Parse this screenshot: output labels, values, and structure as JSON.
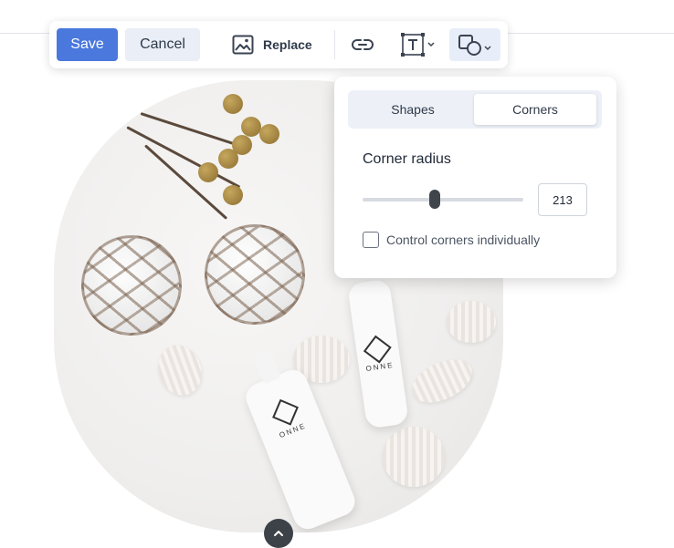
{
  "toolbar": {
    "save_label": "Save",
    "cancel_label": "Cancel",
    "replace_label": "Replace",
    "icons": [
      "image-icon",
      "link-icon",
      "text-box-icon",
      "shapes-icon"
    ]
  },
  "popover": {
    "tabs": [
      {
        "label": "Shapes",
        "selected": false
      },
      {
        "label": "Corners",
        "selected": true
      }
    ],
    "corner_radius_label": "Corner radius",
    "corner_radius_value": "213",
    "control_corners_label": "Control corners individually",
    "control_corners_checked": false
  },
  "image": {
    "brand_text": "ONNE"
  },
  "colors": {
    "accent": "#4a78dd",
    "secondary_button_bg": "#e9eef7",
    "active_icon_bg": "#e8eef9",
    "thumb": "#40454c"
  }
}
